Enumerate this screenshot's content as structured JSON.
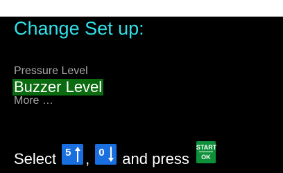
{
  "screen": {
    "title": "Change Set up:",
    "menu": {
      "items": [
        {
          "label": "Pressure Level",
          "selected": false
        },
        {
          "label": "Buzzer Level",
          "selected": true
        },
        {
          "label": "More …",
          "selected": false
        }
      ]
    },
    "instruction": {
      "select_text": "Select",
      "comma": ",",
      "and_press_text": "and press",
      "up_key": {
        "digit": "5",
        "icon": "arrow-up-icon"
      },
      "down_key": {
        "digit": "0",
        "icon": "arrow-down-icon"
      },
      "ok_key": {
        "line1": "START",
        "line2": "OK"
      }
    }
  },
  "colors": {
    "title": "#33e0e8",
    "background": "#000000",
    "selected_highlight": "#0a6b10",
    "key_blue": "#1a6fe0",
    "key_green": "#0e8f3a",
    "inactive_text": "#a8a8a8"
  }
}
